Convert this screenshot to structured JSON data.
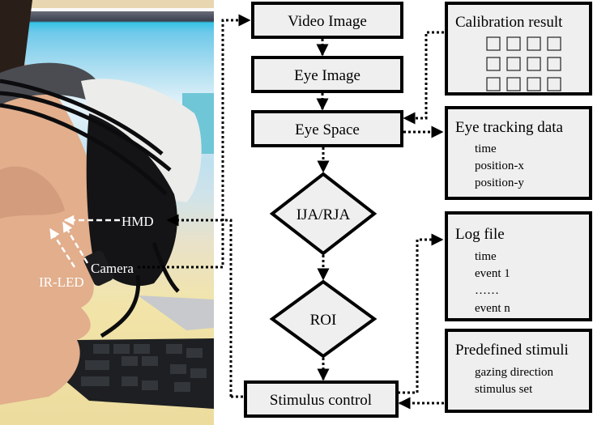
{
  "photo": {
    "description": "side view of child wearing HMD with eye-tracking camera",
    "labels": {
      "hmd": "HMD",
      "camera": "Camera",
      "ir_led": "IR-LED"
    }
  },
  "flow": {
    "video_image": "Video Image",
    "eye_image": "Eye Image",
    "eye_space": "Eye Space",
    "ija_rja": "IJA/RJA",
    "roi": "ROI",
    "stimulus_control": "Stimulus control"
  },
  "side_boxes": {
    "calibration": {
      "title": "Calibration result",
      "grid_rows": 3,
      "grid_cols": 4
    },
    "eye_tracking": {
      "title": "Eye tracking data",
      "items": [
        "time",
        "position-x",
        "position-y"
      ]
    },
    "log_file": {
      "title": "Log file",
      "items": [
        "time",
        "event 1",
        "……",
        "event n"
      ]
    },
    "predefined": {
      "title": "Predefined stimuli",
      "items": [
        "gazing direction",
        "stimulus set"
      ]
    }
  },
  "colors": {
    "box_fill": "#efefef",
    "stroke": "#000000",
    "label_color": "#ffffff"
  }
}
